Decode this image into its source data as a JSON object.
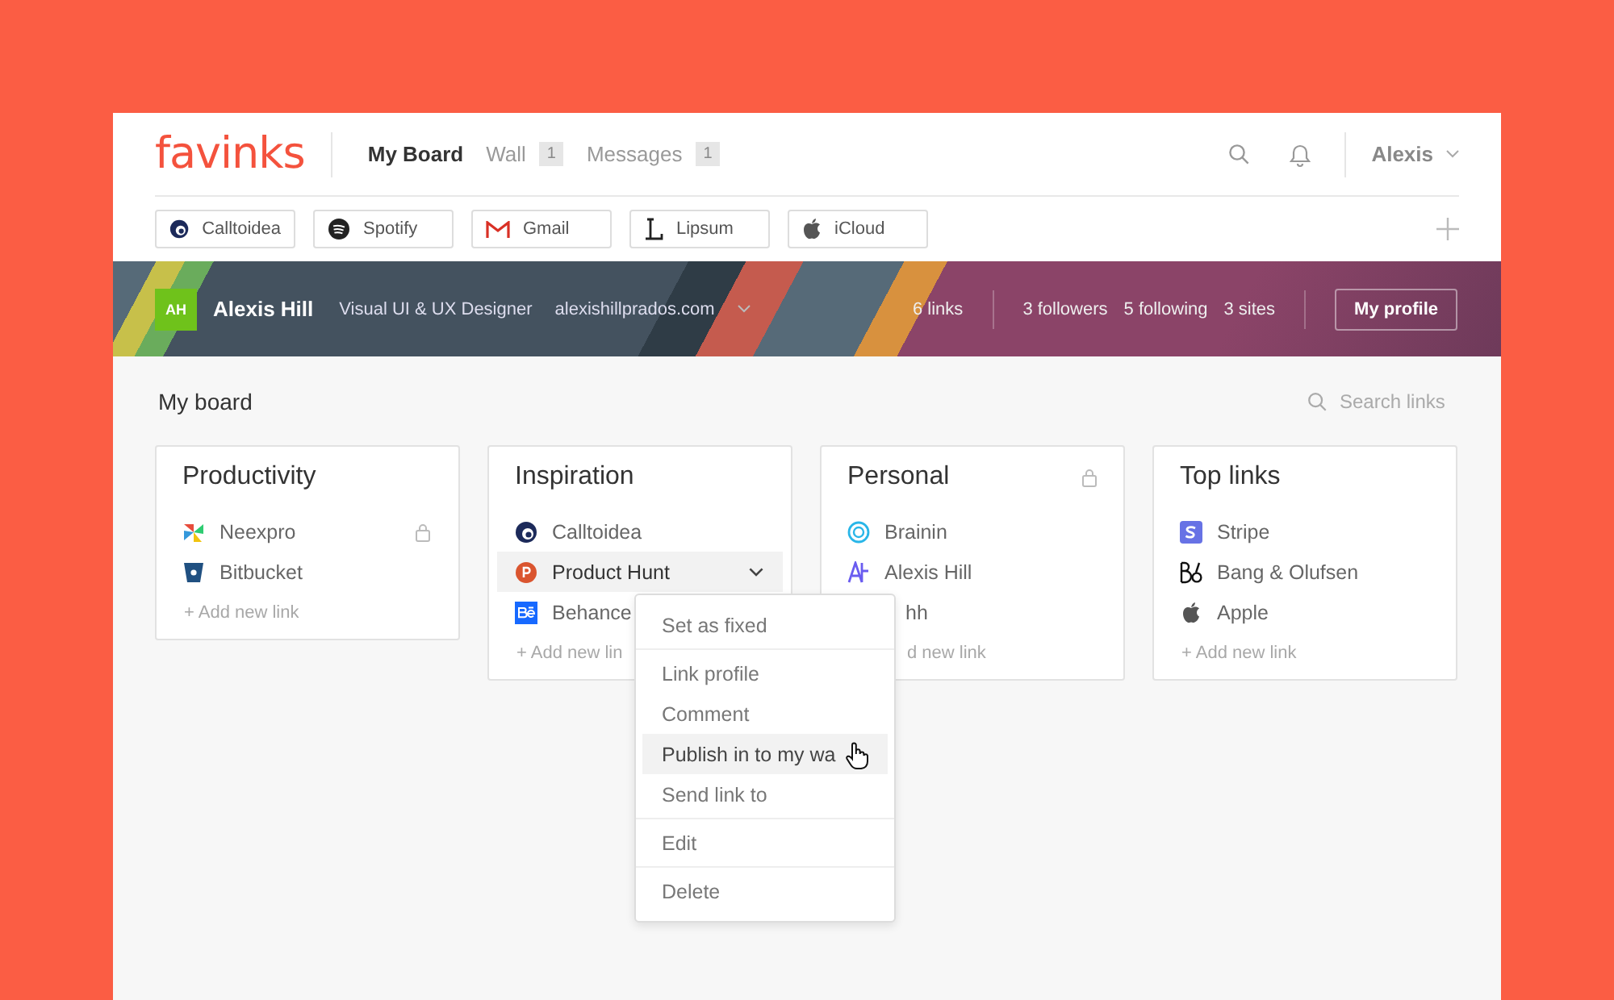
{
  "brand": "favinks",
  "nav": [
    {
      "label": "My Board",
      "selected": true
    },
    {
      "label": "Wall",
      "selected": false,
      "count": "1"
    },
    {
      "label": "Messages",
      "selected": false,
      "count": "1"
    }
  ],
  "user": "Alexis",
  "quick_links": [
    {
      "label": "Calltoidea",
      "kind": "calltoidea"
    },
    {
      "label": "Spotify",
      "kind": "spotify"
    },
    {
      "label": "Gmail",
      "kind": "gmail"
    },
    {
      "label": "Lipsum",
      "kind": "lipsum"
    },
    {
      "label": "iCloud",
      "kind": "apple"
    }
  ],
  "profile": {
    "initials": "AH",
    "name": "Alexis Hill",
    "role": "Visual UI & UX Designer",
    "site": "alexishillprados.com",
    "links": "6 links",
    "followers": "3 followers",
    "following": "5 following",
    "sites": "3 sites",
    "button": "My profile"
  },
  "board": {
    "title": "My board",
    "search_placeholder": "Search links"
  },
  "cards": [
    {
      "title": "Productivity",
      "locked": false,
      "links": [
        {
          "label": "Neexpro",
          "kind": "neexpro",
          "locked": true,
          "selected": false
        },
        {
          "label": "Bitbucket",
          "kind": "bitbucket",
          "locked": false,
          "selected": false
        }
      ],
      "add": "+ Add new link"
    },
    {
      "title": "Inspiration",
      "locked": false,
      "links": [
        {
          "label": "Calltoidea",
          "kind": "calltoidea",
          "locked": false,
          "selected": false
        },
        {
          "label": "Product Hunt",
          "kind": "producthunt",
          "locked": false,
          "selected": true
        },
        {
          "label": "Behance",
          "kind": "behance",
          "selected": false
        }
      ],
      "add": "+ Add new lin",
      "menu": [
        [
          {
            "label": "Set as fixed",
            "selected": false
          }
        ],
        [
          {
            "label": "Link profile",
            "selected": false
          },
          {
            "label": "Comment",
            "selected": false
          },
          {
            "label": "Publish in to my wa",
            "selected": true
          },
          {
            "label": "Send link to",
            "selected": false
          }
        ],
        [
          {
            "label": "Edit",
            "selected": false
          }
        ],
        [
          {
            "label": "Delete",
            "selected": false
          }
        ]
      ]
    },
    {
      "title": "Personal",
      "locked": true,
      "links": [
        {
          "label": "Brainin",
          "kind": "brainin",
          "locked": false,
          "selected": false
        },
        {
          "label": "Alexis Hill",
          "kind": "ah",
          "locked": false,
          "selected": false
        },
        {
          "label": "hh",
          "kind": "cut",
          "locked": false,
          "selected": false
        }
      ],
      "add": "d new link"
    },
    {
      "title": "Top links",
      "locked": false,
      "links": [
        {
          "label": "Stripe",
          "kind": "stripe",
          "locked": false,
          "selected": false
        },
        {
          "label": "Bang & Olufsen",
          "kind": "bo",
          "locked": false,
          "selected": false
        },
        {
          "label": "Apple",
          "kind": "apple",
          "locked": false,
          "selected": false
        }
      ],
      "add": "+ Add new link"
    }
  ]
}
